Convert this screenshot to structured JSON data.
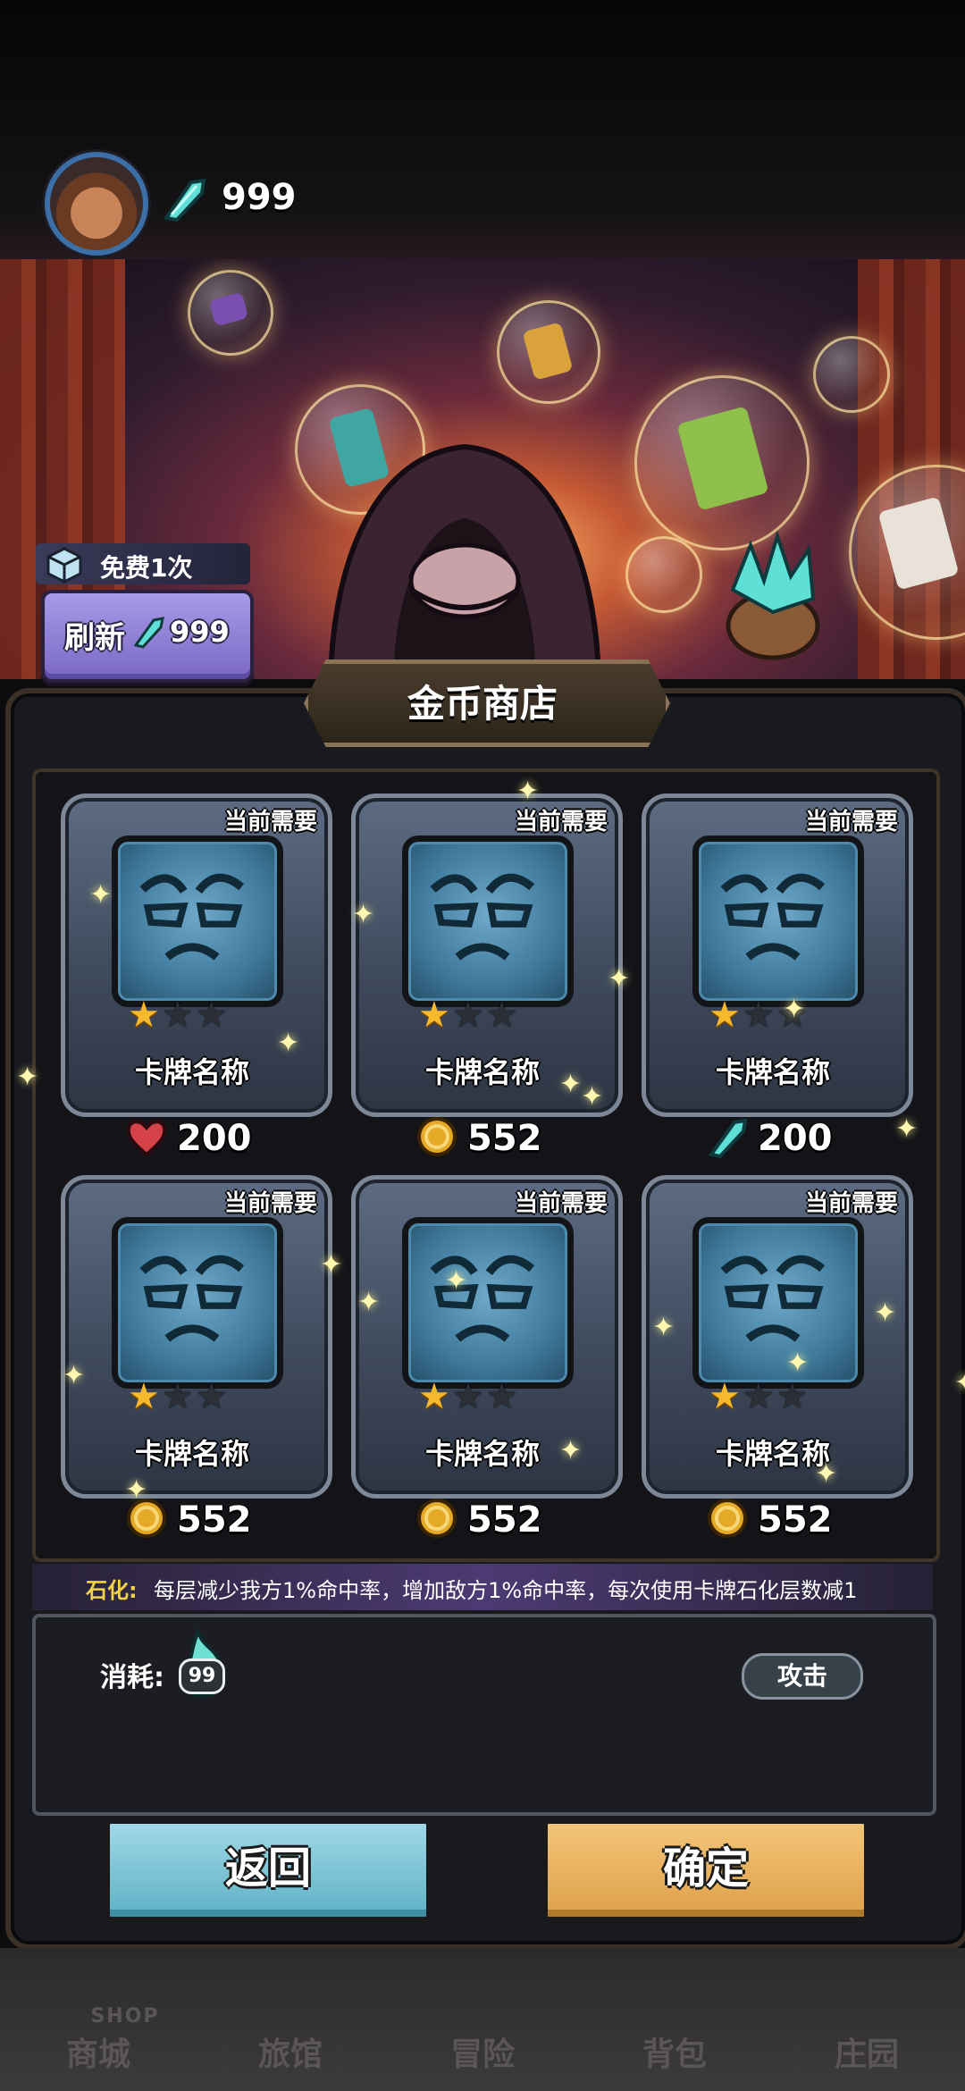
{
  "header": {
    "gem_count": "999"
  },
  "refresh": {
    "free_label": "免费1次",
    "button_label": "刷新",
    "cost": "999"
  },
  "shop": {
    "title": "金币商店"
  },
  "cards": [
    {
      "need": "当前需要",
      "name": "卡牌名称",
      "stars": 1,
      "currency": "heart",
      "price": "200"
    },
    {
      "need": "当前需要",
      "name": "卡牌名称",
      "stars": 1,
      "currency": "coin",
      "price": "552"
    },
    {
      "need": "当前需要",
      "name": "卡牌名称",
      "stars": 1,
      "currency": "gem",
      "price": "200"
    },
    {
      "need": "当前需要",
      "name": "卡牌名称",
      "stars": 1,
      "currency": "coin",
      "price": "552"
    },
    {
      "need": "当前需要",
      "name": "卡牌名称",
      "stars": 1,
      "currency": "coin",
      "price": "552"
    },
    {
      "need": "当前需要",
      "name": "卡牌名称",
      "stars": 1,
      "currency": "coin",
      "price": "552"
    }
  ],
  "description": {
    "keyword": "石化:",
    "text": "每层减少我方1%命中率，增加敌方1%命中率，每次使用卡牌石化层数减1"
  },
  "cost": {
    "label": "消耗:",
    "value": "99",
    "icon": "spirit-flame-icon"
  },
  "attack_label": "攻击",
  "buttons": {
    "back": "返回",
    "confirm": "确定"
  },
  "nav": {
    "shop_en": "SHOP",
    "items": [
      "商城",
      "旅馆",
      "冒险",
      "背包",
      "庄园"
    ]
  },
  "colors": {
    "star_on": "#f6b82c",
    "back_button": "#5fb1c6",
    "confirm_button": "#dea04a",
    "keyword": "#f2d24a"
  }
}
